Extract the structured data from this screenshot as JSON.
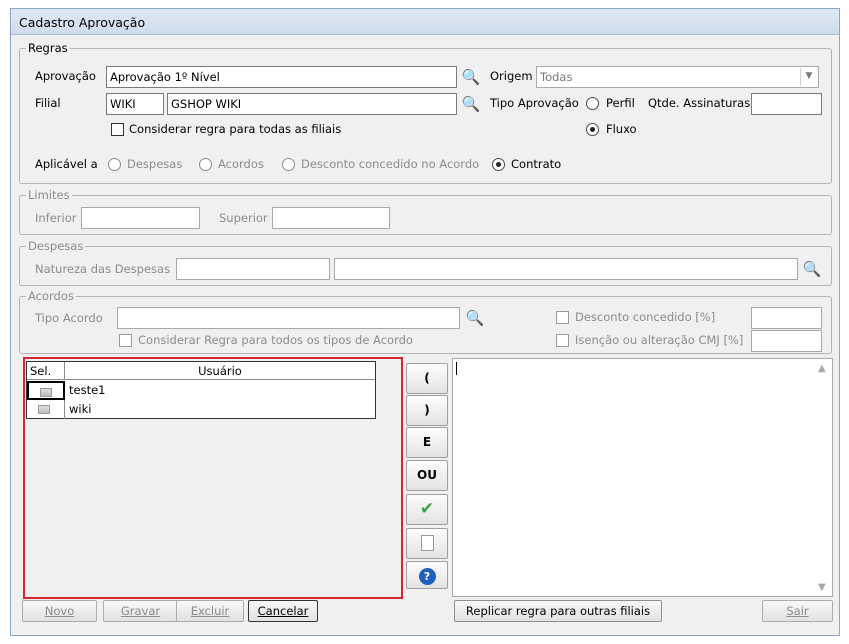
{
  "window": {
    "title": "Cadastro Aprovação"
  },
  "regras": {
    "legend": "Regras",
    "aprovacao_label": "Aprovação",
    "aprovacao_value": "Aprovação 1º Nível",
    "origem_label": "Origem",
    "origem_value": "Todas",
    "filial_label": "Filial",
    "filial_code": "WIKI",
    "filial_name": "GSHOP WIKI",
    "tipo_aprovacao_label": "Tipo Aprovação",
    "perfil_label": "Perfil",
    "fluxo_label": "Fluxo",
    "qtde_label": "Qtde. Assinaturas",
    "qtde_value": "",
    "considerar_filiais_label": "Considerar regra para todas as filiais",
    "aplicavel_label": "Aplicável a",
    "opt_despesas": "Despesas",
    "opt_acordos": "Acordos",
    "opt_desconto": "Desconto concedido no Acordo",
    "opt_contrato": "Contrato"
  },
  "limites": {
    "legend": "Limites",
    "inferior_label": "Inferior",
    "inferior_value": "",
    "superior_label": "Superior",
    "superior_value": ""
  },
  "despesas": {
    "legend": "Despesas",
    "natureza_label": "Natureza das Despesas",
    "natureza_code": "",
    "natureza_desc": ""
  },
  "acordos": {
    "legend": "Acordos",
    "tipo_label": "Tipo Acordo",
    "tipo_value": "",
    "considerar_tipos_label": "Considerar Regra para todos os tipos de Acordo",
    "desconto_label": "Desconto concedido [%]",
    "isencao_label": "Isenção ou alteração CMJ [%]"
  },
  "grid": {
    "col_sel": "Sel.",
    "col_usuario": "Usuário",
    "rows": [
      {
        "usuario": "teste1"
      },
      {
        "usuario": "wiki"
      }
    ]
  },
  "operators": {
    "open_paren": "(",
    "close_paren": ")",
    "and": "E",
    "or": "OU"
  },
  "buttons": {
    "novo": "Novo",
    "gravar": "Gravar",
    "excluir": "Excluir",
    "cancelar": "Cancelar",
    "replicar": "Replicar regra para outras filiais",
    "sair": "Sair"
  },
  "colors": {
    "highlight_border": "#d9262c",
    "check_green": "#3aa53a",
    "help_blue": "#1e5fbf"
  }
}
